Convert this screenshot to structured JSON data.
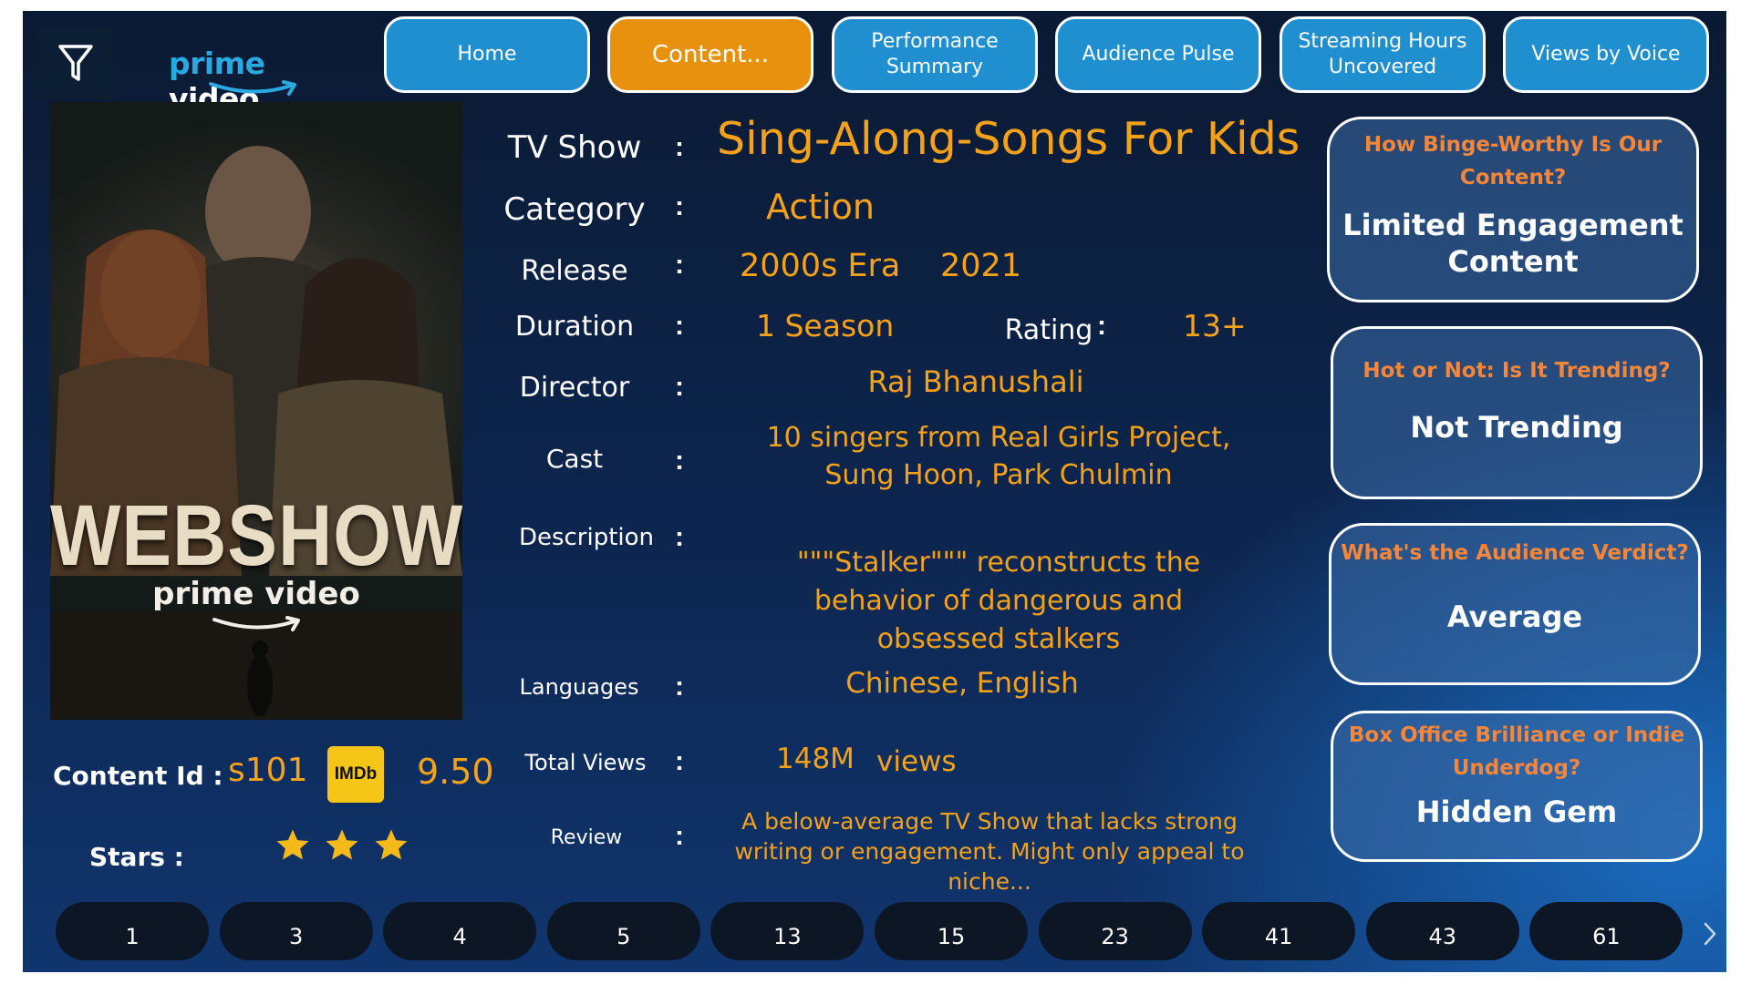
{
  "nav": {
    "items": [
      {
        "label": "Home"
      },
      {
        "label": "Content..."
      },
      {
        "label": "Performance Summary"
      },
      {
        "label": "Audience Pulse"
      },
      {
        "label": "Streaming Hours Uncovered"
      },
      {
        "label": "Views by Voice"
      }
    ],
    "active_index": 1
  },
  "logo": {
    "prime": "prime",
    "video": "video"
  },
  "poster": {
    "title": "WEBSHOW",
    "brand": "prime video"
  },
  "details": {
    "show_label": "TV Show",
    "show_value": "Sing-Along-Songs For Kids",
    "category_label": "Category",
    "category_value": "Action",
    "release_label": "Release",
    "release_era": "2000s Era",
    "release_year": "2021",
    "duration_label": "Duration",
    "duration_value": "1 Season",
    "rating_label": "Rating",
    "rating_value": "13+",
    "director_label": "Director",
    "director_value": "Raj Bhanushali",
    "cast_label": "Cast",
    "cast_value": "10 singers from Real Girls Project, Sung Hoon, Park Chulmin",
    "description_label": "Description",
    "description_value": "\"\"\"Stalker\"\"\" reconstructs the behavior of dangerous and obsessed stalkers",
    "languages_label": "Languages",
    "languages_value": "Chinese, English",
    "views_label": "Total Views",
    "views_value": "148M",
    "views_unit": "views",
    "review_label": "Review",
    "review_value": "A below-average TV Show that lacks strong writing or engagement. Might only appeal to niche..."
  },
  "meta": {
    "content_id_label": "Content Id :",
    "content_id_value": "s101",
    "imdb_badge": "IMDb",
    "imdb_score": "9.50",
    "stars_label": "Stars :",
    "stars_count": 3
  },
  "cards": [
    {
      "question": "How Binge-Worthy Is Our Content?",
      "answer": "Limited Engagement Content"
    },
    {
      "question": "Hot or Not: Is It Trending?",
      "answer": "Not Trending"
    },
    {
      "question": "What's the Audience Verdict?",
      "answer": "Average"
    },
    {
      "question": "Box Office Brilliance or Indie Underdog?",
      "answer": "Hidden Gem"
    }
  ],
  "pager": {
    "pages": [
      "1",
      "3",
      "4",
      "5",
      "13",
      "15",
      "23",
      "41",
      "43",
      "61"
    ],
    "next_icon": "chevron-right-icon"
  },
  "colors": {
    "accent_orange": "#f5a21a",
    "nav_blue": "#1f8fd0",
    "nav_active": "#e8910f",
    "card_question": "#f5863a"
  }
}
